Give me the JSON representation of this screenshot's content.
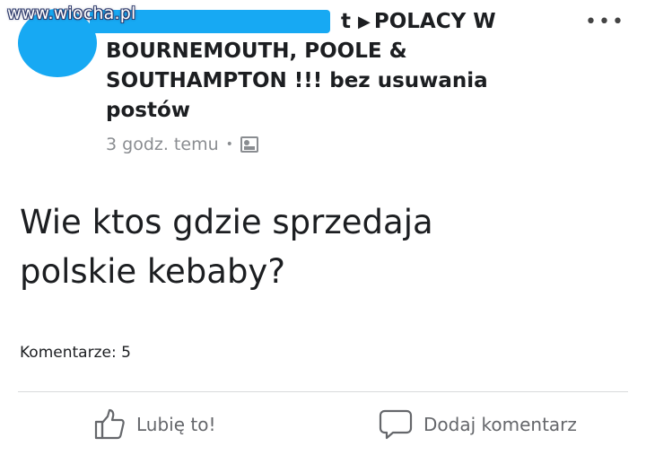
{
  "watermark": "www.wiocha.pl",
  "post": {
    "group_name_lines": [
      "POLACY W",
      "BOURNEMOUTH, POOLE &",
      "SOUTHAMPTON !!! bez usuwania",
      "postów"
    ],
    "name_suffix": "t",
    "timestamp": "3 godz. temu",
    "separator": "•",
    "audience_icon": "group-icon",
    "more_icon": "•••",
    "body_lines": [
      "Wie ktos gdzie sprzedaja",
      "polskie kebaby?"
    ],
    "comments_count": "Komentarze: 5"
  },
  "actions": {
    "like_label": "Lubię to!",
    "comment_label": "Dodaj komentarz"
  },
  "colors": {
    "redaction_blue": "#17a9f3",
    "text_primary": "#1c1e21",
    "text_secondary": "#8a8d91",
    "action_gray": "#65676b"
  }
}
